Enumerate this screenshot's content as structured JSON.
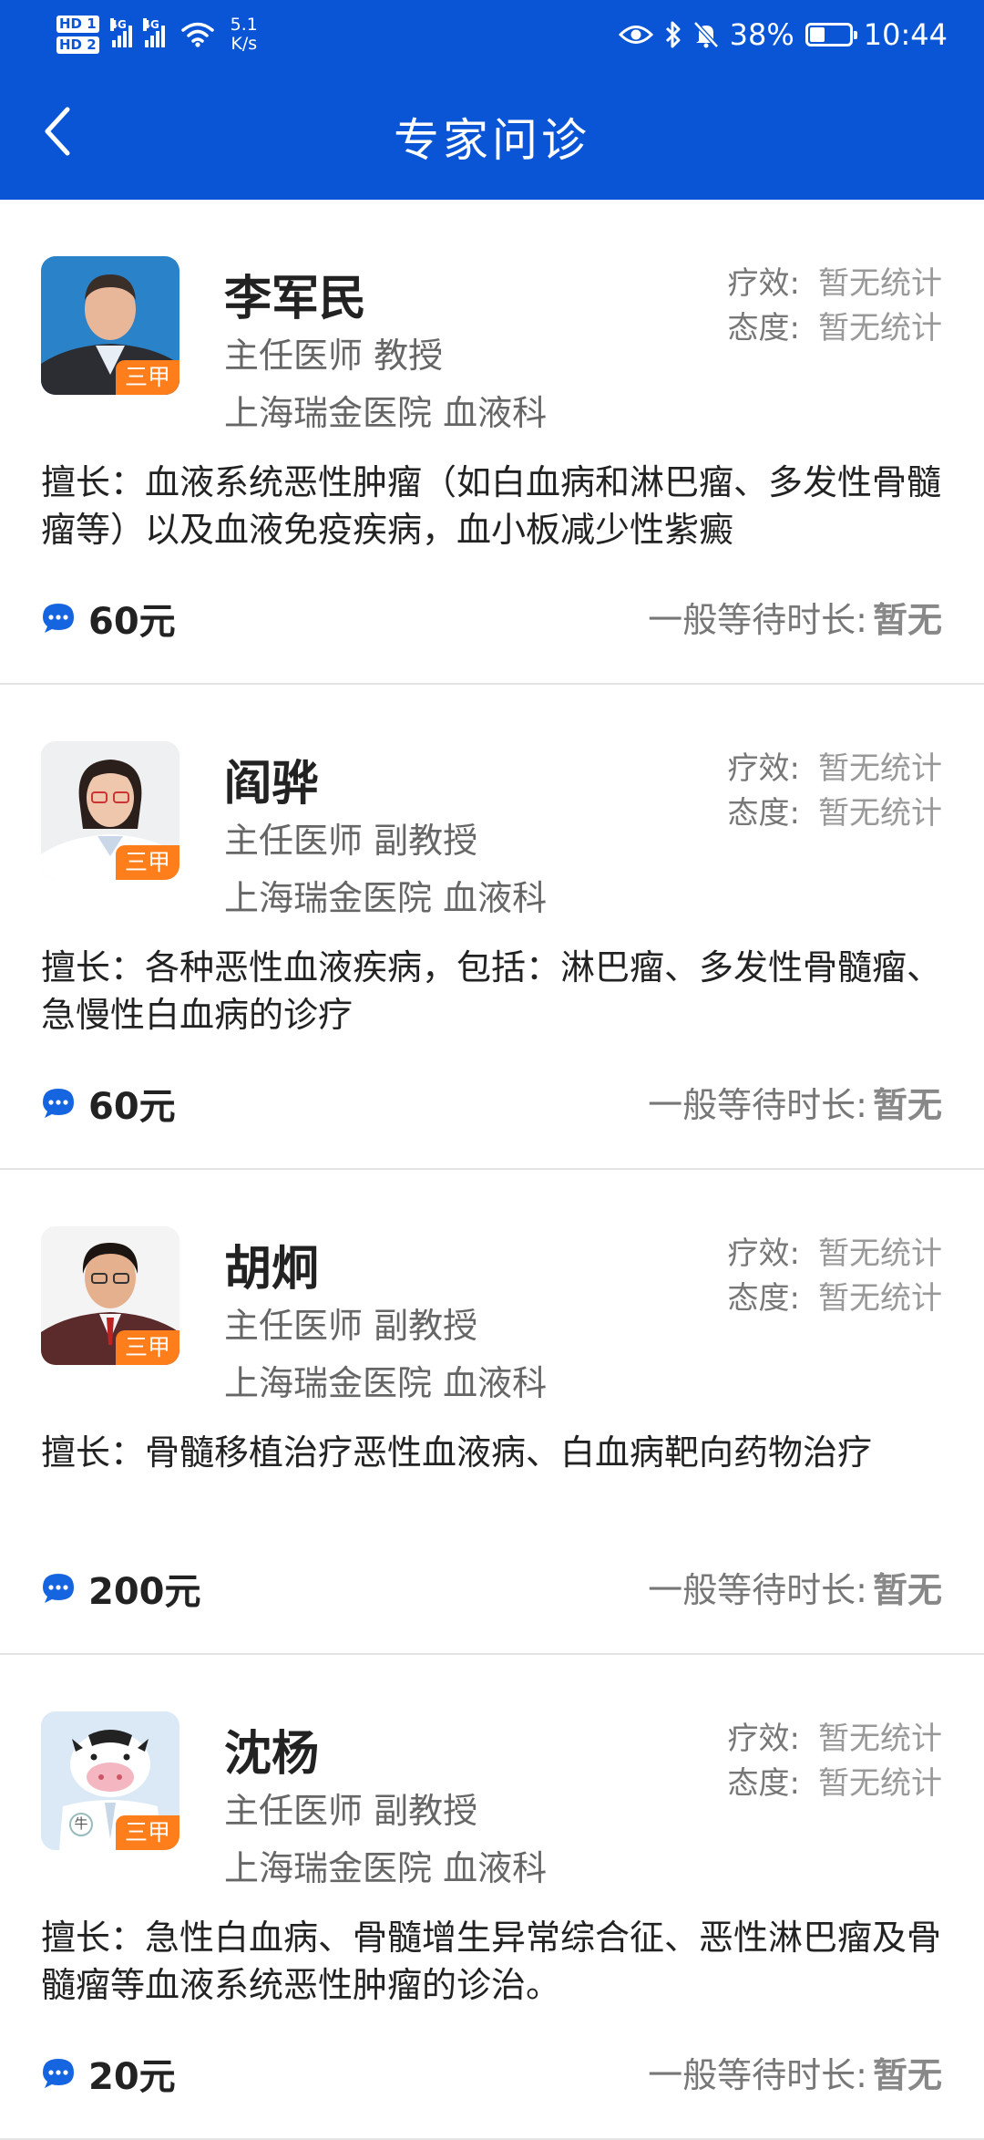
{
  "status_bar": {
    "hd1": "HD 1",
    "hd2": "HD 2",
    "net1": "4G",
    "net2": "4G",
    "speed_value": "5.1",
    "speed_unit": "K/s",
    "battery": "38%",
    "battery_level": 0.38,
    "time": "10:44"
  },
  "header": {
    "title": "专家问诊"
  },
  "colors": {
    "header_bg": "#0a55d6",
    "tag_bg": "#ff7e1c",
    "chat_icon": "#1565e0"
  },
  "doctors": [
    {
      "name": "李军民",
      "title": "主任医师 教授",
      "hospital": "上海瑞金医院 血液科",
      "tag": "三甲",
      "efficacy_label": "疗效:",
      "efficacy_value": "暂无统计",
      "attitude_label": "态度:",
      "attitude_value": "暂无统计",
      "specialty": "擅长：血液系统恶性肿瘤（如白血病和淋巴瘤、多发性骨髓瘤等）以及血液免疫疾病，血小板减少性紫癜",
      "price": "60元",
      "wait_label": "一般等待时长:",
      "wait_value": "暂无"
    },
    {
      "name": "阎骅",
      "title": "主任医师 副教授",
      "hospital": "上海瑞金医院 血液科",
      "tag": "三甲",
      "efficacy_label": "疗效:",
      "efficacy_value": "暂无统计",
      "attitude_label": "态度:",
      "attitude_value": "暂无统计",
      "specialty": "擅长：各种恶性血液疾病，包括：淋巴瘤、多发性骨髓瘤、急慢性白血病的诊疗",
      "price": "60元",
      "wait_label": "一般等待时长:",
      "wait_value": "暂无"
    },
    {
      "name": "胡炯",
      "title": "主任医师 副教授",
      "hospital": "上海瑞金医院 血液科",
      "tag": "三甲",
      "efficacy_label": "疗效:",
      "efficacy_value": "暂无统计",
      "attitude_label": "态度:",
      "attitude_value": "暂无统计",
      "specialty": "擅长：骨髓移植治疗恶性血液病、白血病靶向药物治疗",
      "price": "200元",
      "wait_label": "一般等待时长:",
      "wait_value": "暂无"
    },
    {
      "name": "沈杨",
      "title": "主任医师 副教授",
      "hospital": "上海瑞金医院 血液科",
      "tag": "三甲",
      "avatar_badge": "牛",
      "efficacy_label": "疗效:",
      "efficacy_value": "暂无统计",
      "attitude_label": "态度:",
      "attitude_value": "暂无统计",
      "specialty": "擅长：急性白血病、骨髓增生异常综合征、恶性淋巴瘤及骨髓瘤等血液系统恶性肿瘤的诊治。",
      "price": "20元",
      "wait_label": "一般等待时长:",
      "wait_value": "暂无"
    }
  ]
}
